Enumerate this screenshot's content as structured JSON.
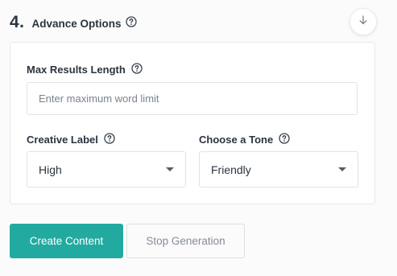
{
  "section": {
    "step_number": "4.",
    "title": "Advance Options"
  },
  "fields": {
    "max_results": {
      "label": "Max Results Length",
      "placeholder": "Enter maximum word limit",
      "value": ""
    },
    "creative_label": {
      "label": "Creative Label",
      "selected": "High"
    },
    "tone": {
      "label": "Choose a Tone",
      "selected": "Friendly"
    }
  },
  "actions": {
    "create": "Create Content",
    "stop": "Stop Generation"
  },
  "colors": {
    "primary": "#22aaa0",
    "text": "#2b3440",
    "muted": "#858c95",
    "border": "#dfe2e6"
  },
  "icons": {
    "help": "question-circle-icon",
    "collapse": "arrow-down-icon",
    "dropdown": "caret-down-icon"
  }
}
